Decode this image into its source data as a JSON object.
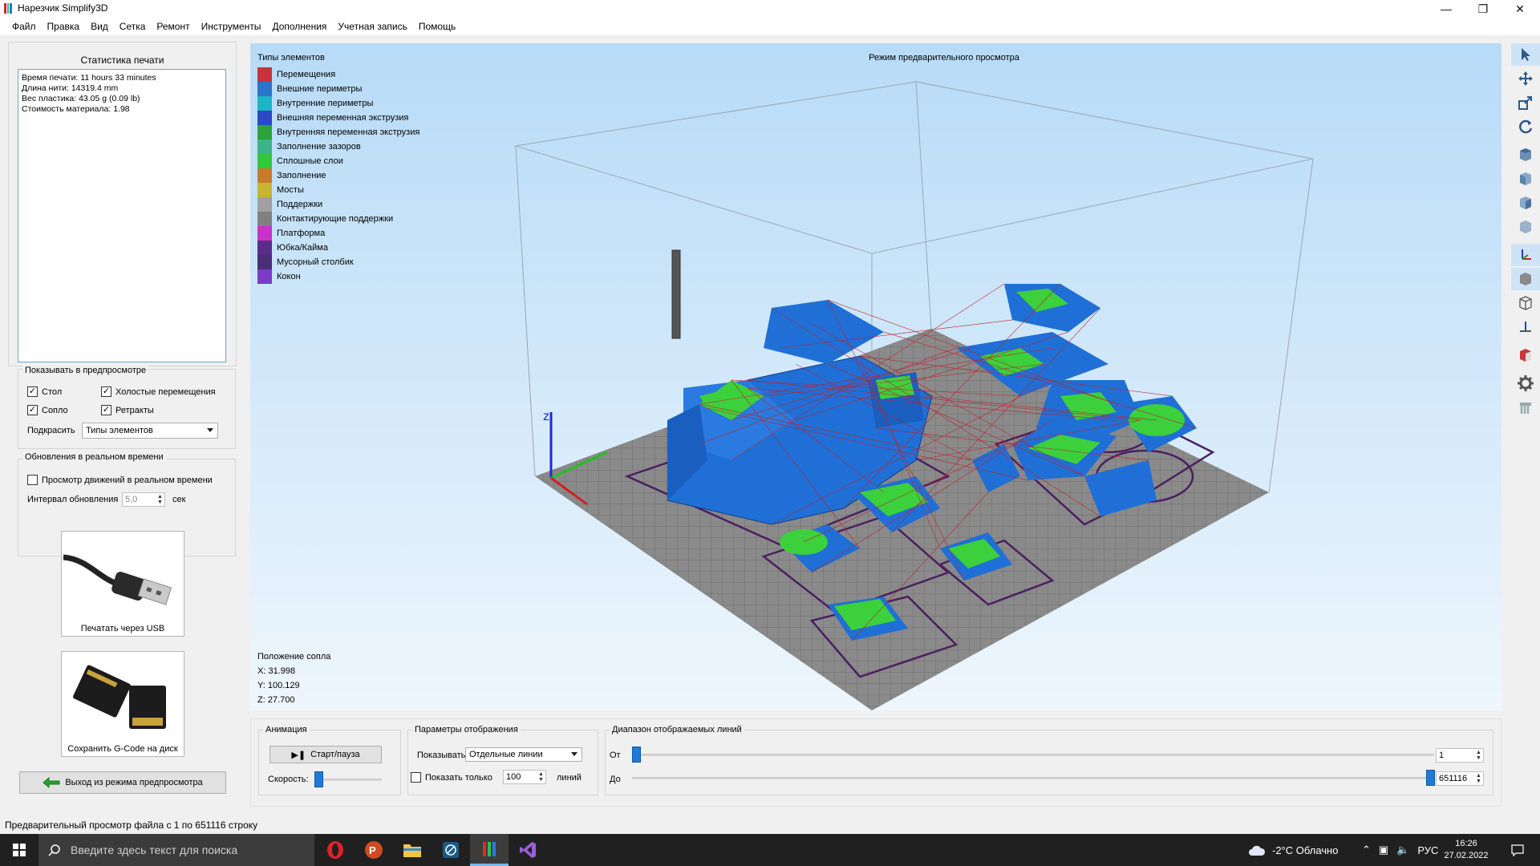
{
  "window": {
    "title": "Нарезчик Simplify3D",
    "minimize_icon": "minimize-icon",
    "maximize_icon": "restore-icon",
    "close_icon": "close-icon"
  },
  "menu": [
    "Файл",
    "Правка",
    "Вид",
    "Сетка",
    "Ремонт",
    "Инструменты",
    "Дополнения",
    "Учетная запись",
    "Помощь"
  ],
  "stats": {
    "title": "Статистика печати",
    "lines": [
      "Время печати: 11 hours 33 minutes",
      "Длина нити: 14319.4 mm",
      "Вес пластика: 43.05 g (0.09 lb)",
      "Стоимость материала: 1.98"
    ]
  },
  "show_in_preview": {
    "title": "Показывать в предпросмотре",
    "table": "Стол",
    "travel": "Холостые перемещения",
    "nozzle": "Сопло",
    "retracts": "Ретракты",
    "color_label": "Подкрасить",
    "color_value": "Типы элементов"
  },
  "realtime": {
    "title": "Обновления в реальном времени",
    "checkbox": "Просмотр движений в реальном времени",
    "interval_label": "Интервал обновления",
    "interval_value": "5,0",
    "unit": "сек"
  },
  "usb": {
    "label": "Печатать через USB"
  },
  "sd": {
    "label": "Сохранить G-Code на диск"
  },
  "exit_button": "Выход из режима предпросмотра",
  "viewport": {
    "legend_title": "Типы элементов",
    "preview_title": "Режим предварительного просмотра",
    "legend": [
      {
        "label": "Перемещения",
        "color": "#c8323c"
      },
      {
        "label": "Внешние периметры",
        "color": "#2c74c8"
      },
      {
        "label": "Внутренние периметры",
        "color": "#1eb4c8"
      },
      {
        "label": "Внешняя переменная экструзия",
        "color": "#2a48c8"
      },
      {
        "label": "Внутренняя переменная экструзия",
        "color": "#2ca23a"
      },
      {
        "label": "Заполнение зазоров",
        "color": "#3cb48a"
      },
      {
        "label": "Сплошные слои",
        "color": "#32c83c"
      },
      {
        "label": "Заполнение",
        "color": "#c87a2c"
      },
      {
        "label": "Мосты",
        "color": "#c8b432"
      },
      {
        "label": "Поддержки",
        "color": "#a0a0a0"
      },
      {
        "label": "Контактирующие поддержки",
        "color": "#808080"
      },
      {
        "label": "Платформа",
        "color": "#c832c8"
      },
      {
        "label": "Юбка/Кайма",
        "color": "#5a2c8a"
      },
      {
        "label": "Мусорный столбик",
        "color": "#4a2e78"
      },
      {
        "label": "Кокон",
        "color": "#7a3cc8"
      }
    ],
    "nozzle_title": "Положение сопла",
    "nozzle_x": "X: 31.998",
    "nozzle_y": "Y: 100.129",
    "nozzle_z": "Z: 27.700"
  },
  "animation": {
    "title": "Анимация",
    "play_button": "Старт/пауза",
    "speed_label": "Скорость:",
    "speed_fraction": 0.0
  },
  "display_params": {
    "title": "Параметры отображения",
    "show_label": "Показывать",
    "show_value": "Отдельные линии",
    "only_label": "Показать только",
    "only_value": "100",
    "lines_label": "линий"
  },
  "range": {
    "title": "Диапазон отображаемых линий",
    "from_label": "От",
    "to_label": "До",
    "from_value": "1",
    "to_value": "651116",
    "from_fraction": 0.0,
    "to_fraction": 1.0
  },
  "statusbar": "Предварительный просмотр файла с 1 по 651116 строку",
  "taskbar": {
    "search_placeholder": "Введите здесь текст для поиска",
    "weather": "-2°C  Облачно",
    "lang": "РУС",
    "time": "16:26",
    "date": "27.02.2022"
  }
}
